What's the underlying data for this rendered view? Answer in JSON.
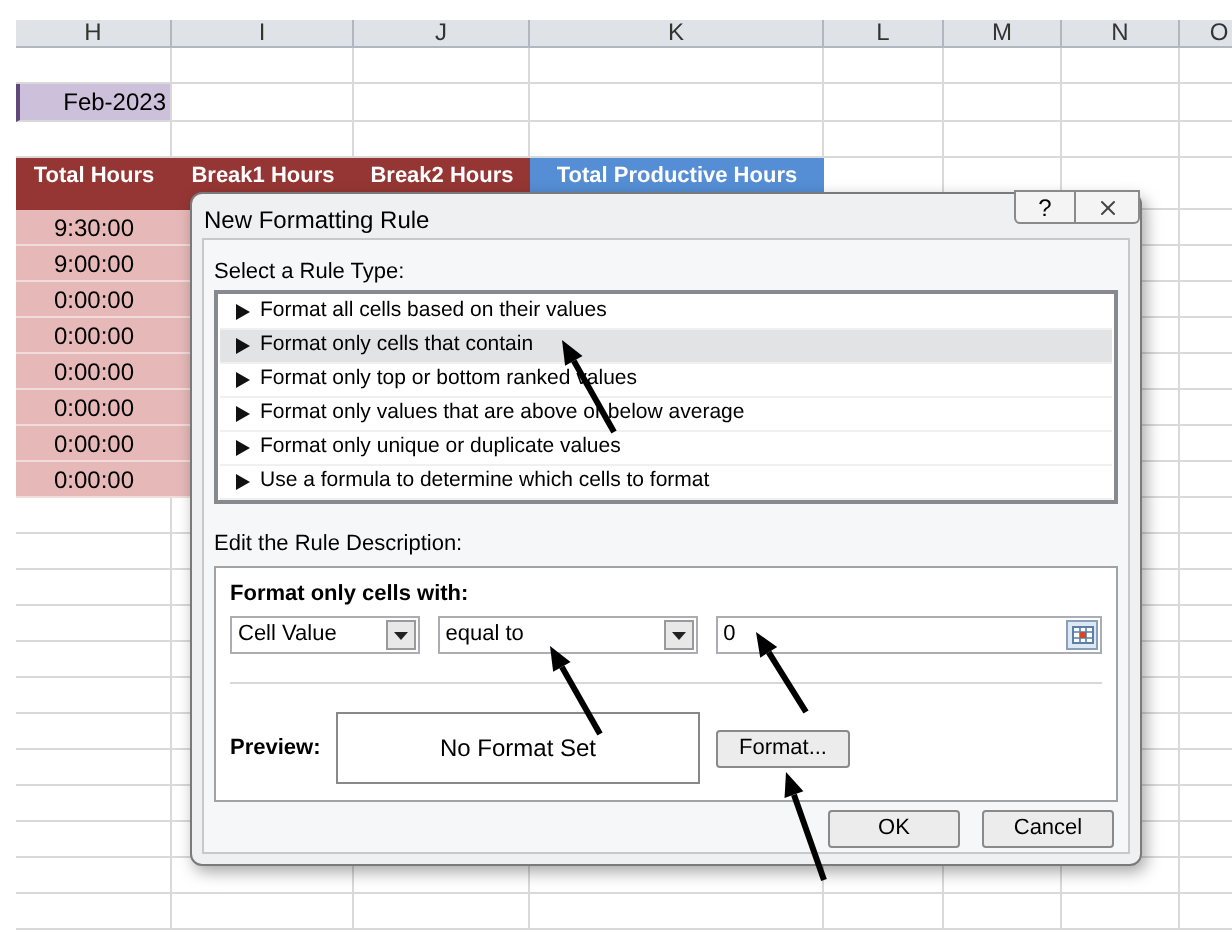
{
  "spreadsheet": {
    "columns": [
      "H",
      "I",
      "J",
      "K",
      "L",
      "M",
      "N",
      "O"
    ],
    "date_cell": "Feb-2023",
    "headers": [
      {
        "text": "Total Hours",
        "color": "#963634"
      },
      {
        "text": "Break1 Hours",
        "color": "#963634"
      },
      {
        "text": "Break2 Hours",
        "color": "#963634"
      },
      {
        "text": "Total Productive Hours",
        "color": "#558ed5"
      }
    ],
    "total_hours": [
      "9:30:00",
      "9:00:00",
      "0:00:00",
      "0:00:00",
      "0:00:00",
      "0:00:00",
      "0:00:00",
      "0:00:00"
    ]
  },
  "dialog": {
    "title": "New Formatting Rule",
    "help": "?",
    "rule_type_label": "Select a Rule Type:",
    "rule_types": [
      {
        "text": "Format all cells based on their values",
        "selected": false
      },
      {
        "text": "Format only cells that contain",
        "selected": true
      },
      {
        "text": "Format only top or bottom ranked values",
        "selected": false
      },
      {
        "text": "Format only values that are above or below average",
        "selected": false
      },
      {
        "text": "Format only unique or duplicate values",
        "selected": false
      },
      {
        "text": "Use a formula to determine which cells to format",
        "selected": false
      }
    ],
    "description_label": "Edit the Rule Description:",
    "condition_label": "Format only cells with:",
    "condition": {
      "subject": "Cell Value",
      "operator": "equal to",
      "value": "0"
    },
    "preview_label": "Preview:",
    "preview_text": "No Format Set",
    "format_button": "Format...",
    "buttons": [
      "OK",
      "Cancel"
    ]
  }
}
